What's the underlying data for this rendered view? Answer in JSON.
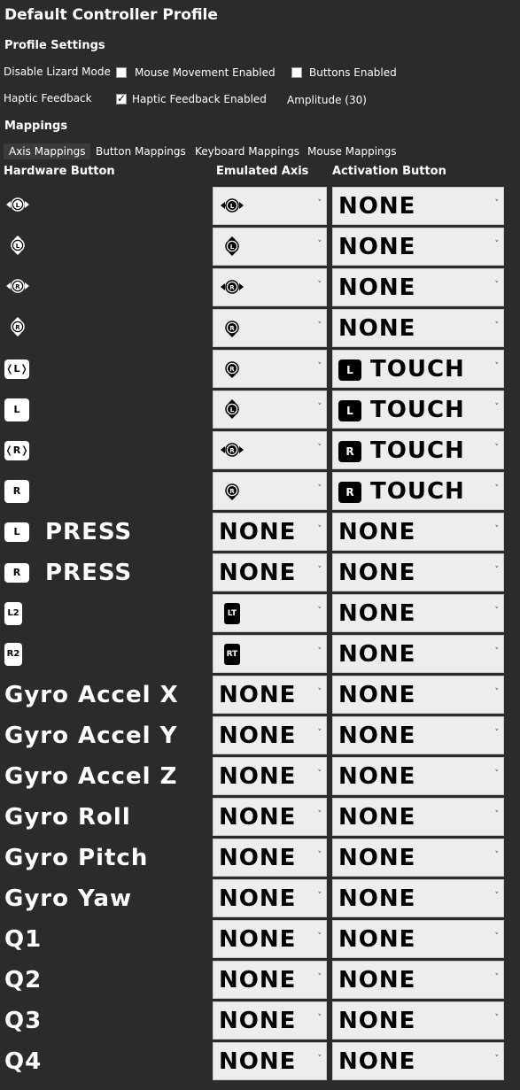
{
  "title": "Default Controller Profile",
  "profile_settings": {
    "heading": "Profile Settings",
    "disable_lizard_label": "Disable Lizard Mode",
    "mouse_movement_label": "Mouse Movement Enabled",
    "mouse_movement_checked": false,
    "buttons_enabled_label": "Buttons Enabled",
    "buttons_enabled_checked": false,
    "haptic_label": "Haptic Feedback",
    "haptic_enabled_label": "Haptic Feedback Enabled",
    "haptic_enabled_checked": true,
    "amplitude_label": "Amplitude (30)"
  },
  "mappings": {
    "heading": "Mappings",
    "tabs": [
      "Axis Mappings",
      "Button Mappings",
      "Keyboard Mappings",
      "Mouse Mappings"
    ],
    "active_tab": "Axis Mappings",
    "columns": [
      "Hardware Button",
      "Emulated Axis",
      "Activation Button"
    ],
    "rows": [
      {
        "hw_icon": "left-stick-horizontal-icon",
        "hw_text": "",
        "axis_icon": "left-stick-horizontal-icon",
        "axis_text": "",
        "act_badge": "",
        "act_text": "NONE"
      },
      {
        "hw_icon": "left-stick-vertical-icon",
        "hw_text": "",
        "axis_icon": "left-stick-vertical-icon",
        "axis_text": "",
        "act_badge": "",
        "act_text": "NONE"
      },
      {
        "hw_icon": "right-stick-horizontal-icon",
        "hw_text": "",
        "axis_icon": "right-stick-horizontal-icon",
        "axis_text": "",
        "act_badge": "",
        "act_text": "NONE"
      },
      {
        "hw_icon": "right-stick-vertical-icon",
        "hw_text": "",
        "axis_icon": "right-stick-down-icon",
        "axis_text": "",
        "act_badge": "",
        "act_text": "NONE"
      },
      {
        "hw_icon": "left-pad-horizontal-icon",
        "hw_badge": "L",
        "hw_text": "",
        "axis_icon": "right-stick-down-icon",
        "axis_text": "",
        "act_badge": "L",
        "act_text": "TOUCH"
      },
      {
        "hw_icon": "left-pad-vertical-icon",
        "hw_badge": "L",
        "hw_text": "",
        "axis_icon": "left-stick-vertical-icon",
        "axis_text": "",
        "act_badge": "L",
        "act_text": "TOUCH"
      },
      {
        "hw_icon": "right-pad-horizontal-icon",
        "hw_badge": "R",
        "hw_text": "",
        "axis_icon": "right-stick-horizontal-icon",
        "axis_text": "",
        "act_badge": "R",
        "act_text": "TOUCH"
      },
      {
        "hw_icon": "right-pad-vertical-icon",
        "hw_badge": "R",
        "hw_text": "",
        "axis_icon": "right-stick-down-icon",
        "axis_text": "",
        "act_badge": "R",
        "act_text": "TOUCH"
      },
      {
        "hw_icon": "left-pad-press-icon",
        "hw_badge": "L",
        "hw_text": "PRESS",
        "axis_icon": "",
        "axis_text": "NONE",
        "act_badge": "",
        "act_text": "NONE"
      },
      {
        "hw_icon": "right-pad-press-icon",
        "hw_badge": "R",
        "hw_text": "PRESS",
        "axis_icon": "",
        "axis_text": "NONE",
        "act_badge": "",
        "act_text": "NONE"
      },
      {
        "hw_icon": "l2-trigger-icon",
        "hw_badge": "L2",
        "hw_text": "",
        "axis_icon": "lt-trigger-icon",
        "axis_badge": "LT",
        "axis_text": "",
        "act_badge": "",
        "act_text": "NONE"
      },
      {
        "hw_icon": "r2-trigger-icon",
        "hw_badge": "R2",
        "hw_text": "",
        "axis_icon": "rt-trigger-icon",
        "axis_badge": "RT",
        "axis_text": "",
        "act_badge": "",
        "act_text": "NONE"
      },
      {
        "hw_icon": "",
        "hw_text": "Gyro Accel X",
        "axis_icon": "",
        "axis_text": "NONE",
        "act_badge": "",
        "act_text": "NONE"
      },
      {
        "hw_icon": "",
        "hw_text": "Gyro Accel Y",
        "axis_icon": "",
        "axis_text": "NONE",
        "act_badge": "",
        "act_text": "NONE"
      },
      {
        "hw_icon": "",
        "hw_text": "Gyro Accel Z",
        "axis_icon": "",
        "axis_text": "NONE",
        "act_badge": "",
        "act_text": "NONE"
      },
      {
        "hw_icon": "",
        "hw_text": "Gyro Roll",
        "axis_icon": "",
        "axis_text": "NONE",
        "act_badge": "",
        "act_text": "NONE"
      },
      {
        "hw_icon": "",
        "hw_text": "Gyro Pitch",
        "axis_icon": "",
        "axis_text": "NONE",
        "act_badge": "",
        "act_text": "NONE"
      },
      {
        "hw_icon": "",
        "hw_text": "Gyro Yaw",
        "axis_icon": "",
        "axis_text": "NONE",
        "act_badge": "",
        "act_text": "NONE"
      },
      {
        "hw_icon": "",
        "hw_text": "Q1",
        "axis_icon": "",
        "axis_text": "NONE",
        "act_badge": "",
        "act_text": "NONE"
      },
      {
        "hw_icon": "",
        "hw_text": "Q2",
        "axis_icon": "",
        "axis_text": "NONE",
        "act_badge": "",
        "act_text": "NONE"
      },
      {
        "hw_icon": "",
        "hw_text": "Q3",
        "axis_icon": "",
        "axis_text": "NONE",
        "act_badge": "",
        "act_text": "NONE"
      },
      {
        "hw_icon": "",
        "hw_text": "Q4",
        "axis_icon": "",
        "axis_text": "NONE",
        "act_badge": "",
        "act_text": "NONE"
      }
    ]
  }
}
